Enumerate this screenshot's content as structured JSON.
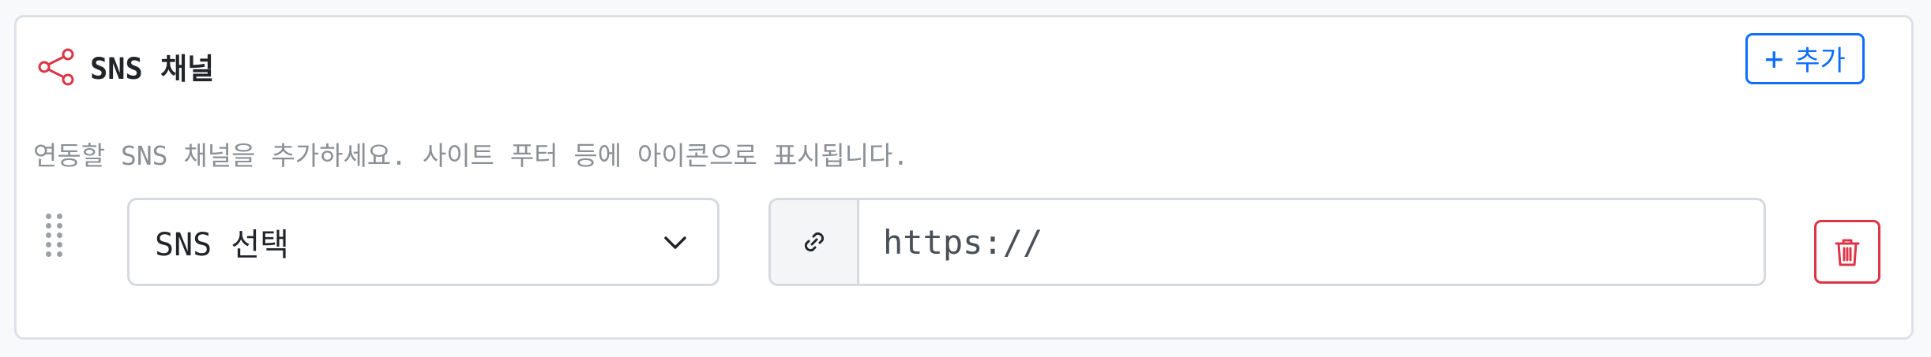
{
  "section": {
    "title": "SNS 채널",
    "icon": "share-icon",
    "description": "연동할 SNS 채널을 추가하세요. 사이트 푸터 등에 아이콘으로 표시됩니다."
  },
  "add_button": {
    "icon": "plus-icon",
    "label": "추가"
  },
  "channel_row": {
    "drag_icon": "drag-handle-icon",
    "select": {
      "selected": "SNS 선택",
      "icon": "chevron-down-icon"
    },
    "url": {
      "prefix_icon": "link-icon",
      "placeholder": "https://",
      "value": ""
    },
    "delete_icon": "trash-icon"
  },
  "colors": {
    "accent": "#0d6efd",
    "danger": "#dc3545",
    "title_icon": "#dc3545",
    "muted_text": "#8a9096",
    "border": "#d6d9dd"
  }
}
